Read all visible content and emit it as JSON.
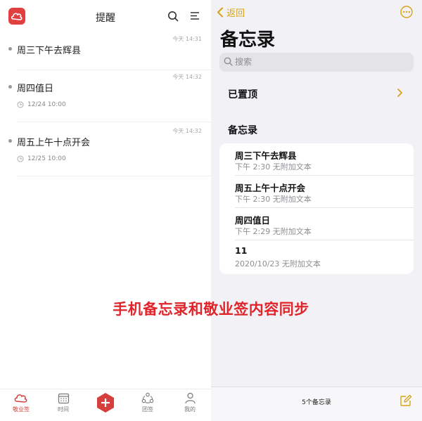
{
  "left": {
    "title": "提醒",
    "reminders": [
      {
        "time": "今天 14:31",
        "title": "周三下午去辉县",
        "date": ""
      },
      {
        "time": "今天 14:32",
        "title": "周四值日",
        "date": "12/24 10:00"
      },
      {
        "time": "今天 14:32",
        "title": "周五上午十点开会",
        "date": "12/25 10:00"
      }
    ],
    "tabs": [
      {
        "label": "敬业签",
        "icon": "cloud-icon"
      },
      {
        "label": "时间",
        "icon": "calendar-icon"
      },
      {
        "label": "团签",
        "icon": "group-icon"
      },
      {
        "label": "我的",
        "icon": "person-icon"
      }
    ],
    "colors": {
      "accent": "#d6403c"
    }
  },
  "right": {
    "back_label": "返回",
    "title": "备忘录",
    "search_placeholder": "搜索",
    "pinned_label": "已置顶",
    "section_title": "备忘录",
    "notes": [
      {
        "title": "周三下午去辉县",
        "meta": "下午 2:30  无附加文本"
      },
      {
        "title": "周五上午十点开会",
        "meta": "下午 2:30  无附加文本"
      },
      {
        "title": "周四值日",
        "meta": "下午 2:29  无附加文本"
      },
      {
        "title": "11",
        "meta": "2020/10/23  无附加文本"
      }
    ],
    "note_count": "5个备忘录",
    "colors": {
      "accent": "#d5a316"
    }
  },
  "caption": "手机备忘录和敬业签内容同步"
}
